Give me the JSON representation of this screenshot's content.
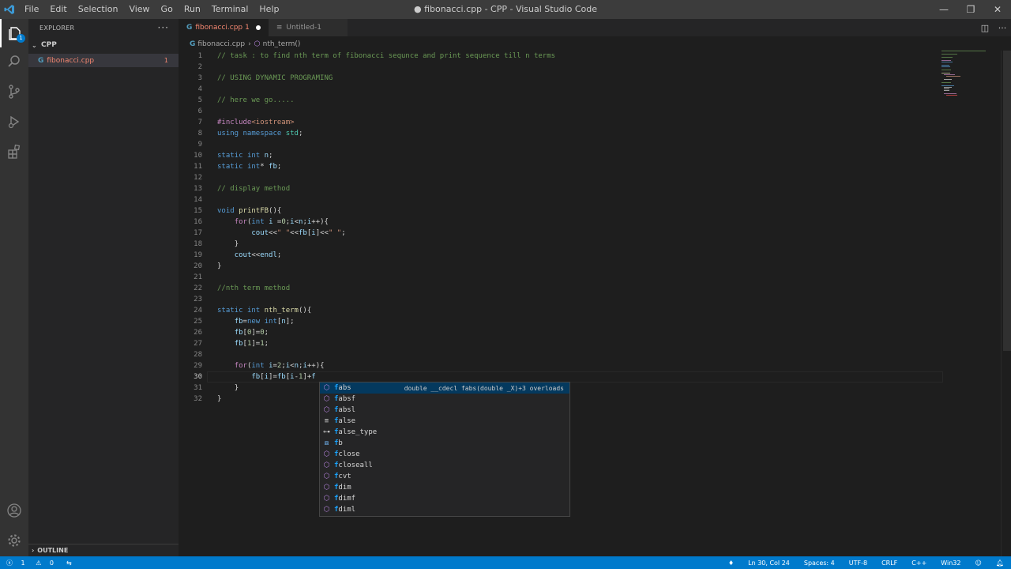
{
  "window": {
    "title": "● fibonacci.cpp - CPP - Visual Studio Code",
    "menu": [
      "File",
      "Edit",
      "Selection",
      "View",
      "Go",
      "Run",
      "Terminal",
      "Help"
    ],
    "controls": [
      "—",
      "❐",
      "✕"
    ]
  },
  "activity": {
    "explorer_badge": "1"
  },
  "sidebar": {
    "title": "EXPLORER",
    "more": "···",
    "folder": "CPP",
    "file": "fibonacci.cpp",
    "file_problems": "1",
    "outline": "OUTLINE"
  },
  "tabs": [
    {
      "label": "fibonacci.cpp",
      "problems": "1"
    },
    {
      "label": "Untitled-1"
    }
  ],
  "breadcrumb": {
    "file": "fibonacci.cpp",
    "symbol": "nth_term()"
  },
  "editor": {
    "current_line": 30,
    "lines": [
      "// task : to find nth term of fibonacci sequnce and print sequence till n terms",
      "",
      "// USING DYNAMIC PROGRAMING",
      "",
      "// here we go.....",
      "",
      "#include<iostream>",
      "using namespace std;",
      "",
      "static int n;",
      "static int* fb;",
      "",
      "// display method",
      "",
      "void printFB(){",
      "    for(int i =0;i<n;i++){",
      "        cout<<\" \"<<fb[i]<<\" \";",
      "    }",
      "    cout<<endl;",
      "}",
      "",
      "//nth term method",
      "",
      "static int nth_term(){",
      "    fb=new int[n];",
      "    fb[0]=0;",
      "    fb[1]=1;",
      "",
      "    for(int i=2;i<n;i++){",
      "        fb[i]=fb[i-1]+f",
      "    }",
      "}"
    ]
  },
  "suggest": {
    "detail": "double __cdecl fabs(double _X)+3 overloads",
    "items": [
      {
        "label": "fabs",
        "kind": "method"
      },
      {
        "label": "fabsf",
        "kind": "method"
      },
      {
        "label": "fabsl",
        "kind": "method"
      },
      {
        "label": "false",
        "kind": "keyword"
      },
      {
        "label": "false_type",
        "kind": "class"
      },
      {
        "label": "fb",
        "kind": "variable"
      },
      {
        "label": "fclose",
        "kind": "method"
      },
      {
        "label": "fcloseall",
        "kind": "method"
      },
      {
        "label": "fcvt",
        "kind": "method"
      },
      {
        "label": "fdim",
        "kind": "method"
      },
      {
        "label": "fdimf",
        "kind": "method"
      },
      {
        "label": "fdiml",
        "kind": "method"
      }
    ]
  },
  "status": {
    "errors": "1",
    "warnings": "0",
    "position": "Ln 30, Col 24",
    "spaces": "Spaces: 4",
    "encoding": "UTF-8",
    "eol": "CRLF",
    "language": "C++",
    "platform": "Win32"
  }
}
